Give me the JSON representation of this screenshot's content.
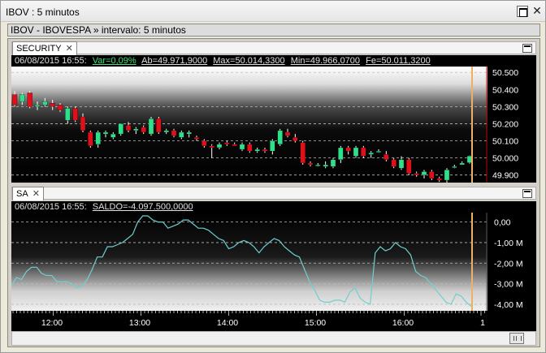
{
  "window": {
    "title": "IBOV : 5 minutos",
    "close_glyph": "✕"
  },
  "subtitle": "IBOV - IBOVESPA » intervalo: 5 minutos",
  "security_panel": {
    "tab_label": "SECURITY",
    "tab_close": "✕",
    "info": {
      "date": "06/08/2015 16:55:",
      "var": "Var=0,09%",
      "ab": "Ab=49.971,9000",
      "max": "Max=50.014,3300",
      "min": "Min=49.966,0700",
      "fe": "Fe=50.011,3200"
    },
    "y_ticks": [
      "50.500",
      "50.400",
      "50.300",
      "50.200",
      "50.100",
      "50.000",
      "49.900"
    ],
    "colors": {
      "up": "#2ee08a",
      "down": "#e0101a",
      "current_line": "#f0b060",
      "price_line": "#c00000",
      "grid": "#bbbbbb"
    }
  },
  "sa_panel": {
    "tab_label": "SA",
    "tab_close": "✕",
    "info": {
      "date": "06/08/2015 16:55:",
      "saldo": "SALDO=-4.097.500,0000"
    },
    "y_ticks": [
      "0,00",
      "-1,00 M",
      "-2,00 M",
      "-3,00 M",
      "-4,00 M"
    ],
    "line_color": "#6fcfcf"
  },
  "time_axis": {
    "labels": [
      "12:00",
      "13:00",
      "14:00",
      "15:00",
      "16:00",
      "1"
    ]
  },
  "chart_data": [
    {
      "type": "candlestick",
      "title": "SECURITY",
      "ylim": [
        49870,
        50520
      ],
      "candles": [
        {
          "o": 50370,
          "h": 50390,
          "l": 50300,
          "c": 50310
        },
        {
          "o": 50330,
          "h": 50380,
          "l": 50310,
          "c": 50370
        },
        {
          "o": 50380,
          "h": 50390,
          "l": 50290,
          "c": 50300
        },
        {
          "o": 50300,
          "h": 50330,
          "l": 50280,
          "c": 50310
        },
        {
          "o": 50310,
          "h": 50350,
          "l": 50300,
          "c": 50330
        },
        {
          "o": 50320,
          "h": 50340,
          "l": 50280,
          "c": 50300
        },
        {
          "o": 50310,
          "h": 50320,
          "l": 50270,
          "c": 50280
        },
        {
          "o": 50220,
          "h": 50300,
          "l": 50200,
          "c": 50290
        },
        {
          "o": 50290,
          "h": 50300,
          "l": 50210,
          "c": 50220
        },
        {
          "o": 50240,
          "h": 50260,
          "l": 50150,
          "c": 50160
        },
        {
          "o": 50150,
          "h": 50160,
          "l": 50060,
          "c": 50070
        },
        {
          "o": 50080,
          "h": 50160,
          "l": 50060,
          "c": 50150
        },
        {
          "o": 50140,
          "h": 50160,
          "l": 50120,
          "c": 50150
        },
        {
          "o": 50120,
          "h": 50150,
          "l": 50110,
          "c": 50140
        },
        {
          "o": 50140,
          "h": 50200,
          "l": 50130,
          "c": 50200
        },
        {
          "o": 50190,
          "h": 50210,
          "l": 50150,
          "c": 50160
        },
        {
          "o": 50160,
          "h": 50180,
          "l": 50140,
          "c": 50170
        },
        {
          "o": 50180,
          "h": 50190,
          "l": 50140,
          "c": 50150
        },
        {
          "o": 50140,
          "h": 50240,
          "l": 50130,
          "c": 50230
        },
        {
          "o": 50230,
          "h": 50240,
          "l": 50140,
          "c": 50150
        },
        {
          "o": 50150,
          "h": 50170,
          "l": 50140,
          "c": 50160
        },
        {
          "o": 50160,
          "h": 50170,
          "l": 50120,
          "c": 50130
        },
        {
          "o": 50120,
          "h": 50160,
          "l": 50110,
          "c": 50150
        },
        {
          "o": 50140,
          "h": 50160,
          "l": 50120,
          "c": 50150
        },
        {
          "o": 50120,
          "h": 50130,
          "l": 50100,
          "c": 50110
        },
        {
          "o": 50100,
          "h": 50110,
          "l": 50060,
          "c": 50070
        },
        {
          "o": 50070,
          "h": 50080,
          "l": 50000,
          "c": 50060
        },
        {
          "o": 50060,
          "h": 50090,
          "l": 50050,
          "c": 50080
        },
        {
          "o": 50090,
          "h": 50100,
          "l": 50070,
          "c": 50080
        },
        {
          "o": 50080,
          "h": 50090,
          "l": 50070,
          "c": 50070
        },
        {
          "o": 50050,
          "h": 50090,
          "l": 50040,
          "c": 50080
        },
        {
          "o": 50080,
          "h": 50090,
          "l": 50030,
          "c": 50040
        },
        {
          "o": 50040,
          "h": 50060,
          "l": 50030,
          "c": 50050
        },
        {
          "o": 50050,
          "h": 50060,
          "l": 50030,
          "c": 50040
        },
        {
          "o": 50040,
          "h": 50110,
          "l": 50020,
          "c": 50100
        },
        {
          "o": 50080,
          "h": 50170,
          "l": 50070,
          "c": 50160
        },
        {
          "o": 50150,
          "h": 50170,
          "l": 50120,
          "c": 50130
        },
        {
          "o": 50120,
          "h": 50140,
          "l": 50090,
          "c": 50100
        },
        {
          "o": 50090,
          "h": 50100,
          "l": 49960,
          "c": 49970
        },
        {
          "o": 49970,
          "h": 49980,
          "l": 49950,
          "c": 49960
        },
        {
          "o": 49960,
          "h": 49970,
          "l": 49950,
          "c": 49960
        },
        {
          "o": 49950,
          "h": 49980,
          "l": 49940,
          "c": 49960
        },
        {
          "o": 49950,
          "h": 50000,
          "l": 49940,
          "c": 49990
        },
        {
          "o": 49990,
          "h": 50070,
          "l": 49970,
          "c": 50060
        },
        {
          "o": 50060,
          "h": 50070,
          "l": 50020,
          "c": 50040
        },
        {
          "o": 50010,
          "h": 50070,
          "l": 50000,
          "c": 50060
        },
        {
          "o": 50060,
          "h": 50070,
          "l": 50000,
          "c": 50010
        },
        {
          "o": 50020,
          "h": 50040,
          "l": 50000,
          "c": 50030
        },
        {
          "o": 50040,
          "h": 50050,
          "l": 50030,
          "c": 50040
        },
        {
          "o": 50020,
          "h": 50040,
          "l": 49980,
          "c": 49990
        },
        {
          "o": 49990,
          "h": 50000,
          "l": 49940,
          "c": 49950
        },
        {
          "o": 49940,
          "h": 50010,
          "l": 49930,
          "c": 49990
        },
        {
          "o": 49990,
          "h": 50000,
          "l": 49900,
          "c": 49910
        },
        {
          "o": 49910,
          "h": 49920,
          "l": 49890,
          "c": 49900
        },
        {
          "o": 49900,
          "h": 49930,
          "l": 49880,
          "c": 49920
        },
        {
          "o": 49920,
          "h": 49930,
          "l": 49870,
          "c": 49880
        },
        {
          "o": 49880,
          "h": 49890,
          "l": 49860,
          "c": 49870
        },
        {
          "o": 49870,
          "h": 49940,
          "l": 49850,
          "c": 49930
        },
        {
          "o": 49950,
          "h": 49960,
          "l": 49940,
          "c": 49950
        },
        {
          "o": 49960,
          "h": 49980,
          "l": 49960,
          "c": 49970
        },
        {
          "o": 49972,
          "h": 50014,
          "l": 49966,
          "c": 50011
        }
      ]
    },
    {
      "type": "line",
      "title": "SA",
      "ylim": [
        -4.2,
        0.3
      ],
      "series": [
        {
          "values": [
            -3.1,
            -2.7,
            -2.8,
            -2.4,
            -2.2,
            -2.2,
            -2.5,
            -2.6,
            -2.6,
            -2.9,
            -2.9,
            -2.9,
            -3.0,
            -3.2,
            -3.1,
            -2.8,
            -2.3,
            -1.7,
            -1.7,
            -1.2,
            -1.2,
            -1.1,
            -1.0,
            -0.8,
            -0.6,
            0.0,
            0.3,
            0.3,
            0.1,
            0.0,
            0.0,
            -0.3,
            -0.2,
            -0.1,
            0.1,
            0.1,
            -0.1,
            -0.3,
            -0.3,
            -0.4,
            -0.6,
            -0.8,
            -0.9,
            -1.3,
            -1.2,
            -1.0,
            -0.9,
            -1.0,
            -1.2,
            -1.5,
            -1.2,
            -1.0,
            -0.8,
            -0.9,
            -1.2,
            -1.4,
            -1.6,
            -1.7,
            -2.3,
            -2.9,
            -3.3,
            -3.8,
            -3.9,
            -3.9,
            -3.8,
            -3.8,
            -3.9,
            -3.4,
            -3.2,
            -3.7,
            -3.9,
            -4.0,
            -1.5,
            -1.2,
            -1.4,
            -1.3,
            -1.0,
            -1.2,
            -1.3,
            -1.6,
            -2.4,
            -2.6,
            -2.7,
            -3.0,
            -3.3,
            -3.6,
            -3.9,
            -4.0,
            -3.5,
            -3.6,
            -3.9,
            -4.1
          ]
        }
      ]
    }
  ]
}
